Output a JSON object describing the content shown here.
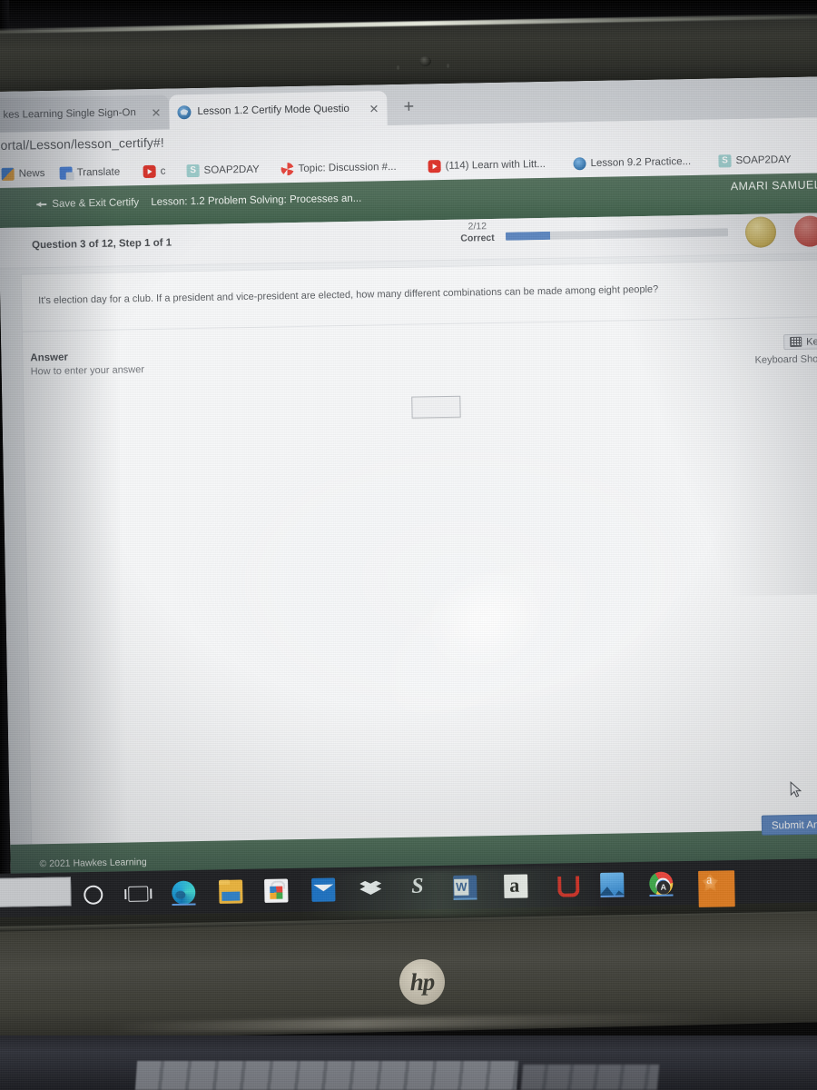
{
  "browser": {
    "tabs": [
      {
        "title": "kes Learning Single Sign-On",
        "close": "✕",
        "active": false,
        "favicon": "hawkes-icon"
      },
      {
        "title": "Lesson 1.2 Certify Mode Questio",
        "close": "✕",
        "active": true,
        "favicon": "hawkes-icon"
      }
    ],
    "new_tab_label": "+",
    "url": "Portal/Lesson/lesson_certify#!",
    "bookmarks": [
      {
        "label": "News",
        "icon": "news-icon"
      },
      {
        "label": "Translate",
        "icon": "translate-icon"
      },
      {
        "label": "c",
        "icon": "youtube-icon"
      },
      {
        "label": "SOAP2DAY",
        "icon": "soap2day-icon"
      },
      {
        "label": "Topic: Discussion #...",
        "icon": "topic-icon"
      },
      {
        "label": "(114) Learn with Litt...",
        "icon": "youtube-icon"
      },
      {
        "label": "Lesson 9.2 Practice...",
        "icon": "hawkes-icon"
      },
      {
        "label": "SOAP2DAY",
        "icon": "soap2day-icon"
      }
    ]
  },
  "app": {
    "header": {
      "save_exit_label": "Save & Exit Certify",
      "lesson_title": "Lesson: 1.2 Problem Solving: Processes an...",
      "user_name": "AMARI SAMUEL"
    },
    "status": {
      "question_position": "Question 3 of 12, Step 1 of 1",
      "score_value": "2/12",
      "score_label": "Correct",
      "progress_percent": 20
    },
    "question": {
      "text": "It's election day for a club.  If a president and vice-president are elected, how many different combinations can be made among eight people?"
    },
    "answer": {
      "section_title": "Answer",
      "help_label": "How to enter your answer",
      "input_value": "",
      "keyboard_button_label": "Key",
      "keyboard_shortcut_label": "Keyboard Sho"
    },
    "footer": {
      "copyright": "© 2021 Hawkes Learning",
      "submit_label": "Submit Answ"
    }
  },
  "taskbar": {
    "search_placeholder": "",
    "items": [
      {
        "name": "cortana-icon",
        "label": "Cortana"
      },
      {
        "name": "task-view-icon",
        "label": "Task View"
      },
      {
        "name": "edge-icon",
        "label": "Microsoft Edge"
      },
      {
        "name": "file-explorer-icon",
        "label": "File Explorer"
      },
      {
        "name": "microsoft-store-icon",
        "label": "Microsoft Store"
      },
      {
        "name": "mail-icon",
        "label": "Mail"
      },
      {
        "name": "dropbox-icon",
        "label": "Dropbox"
      },
      {
        "name": "slack-icon",
        "label": "S"
      },
      {
        "name": "word-icon",
        "label": "Word"
      },
      {
        "name": "amazon-icon",
        "label": "Amazon"
      },
      {
        "name": "u-app-icon",
        "label": "U"
      },
      {
        "name": "photos-icon",
        "label": "Photos"
      },
      {
        "name": "chrome-icon",
        "label": "Chrome",
        "badge": "A"
      },
      {
        "name": "orange-app-icon",
        "label": "a"
      }
    ]
  },
  "device": {
    "brand_logo": "hp"
  },
  "colors": {
    "app_green": "#4b6a55",
    "accent_blue": "#5d86bf",
    "footer_green": "#456350",
    "card_bg": "#f7f8f9"
  }
}
